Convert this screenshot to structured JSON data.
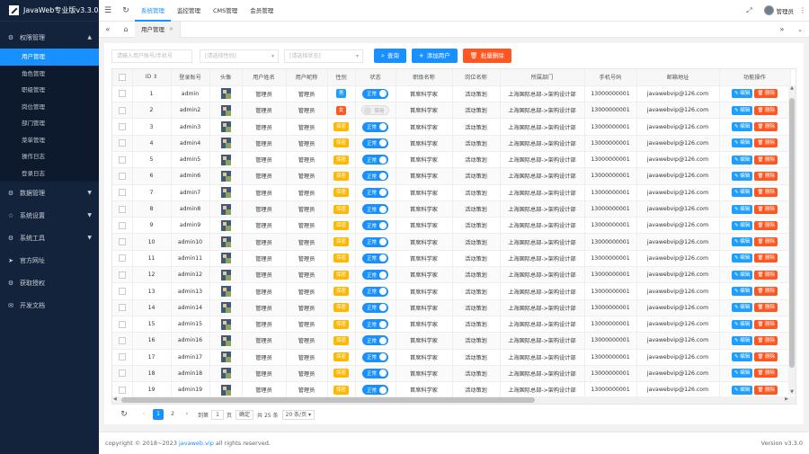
{
  "app": {
    "title": "JavaWeb专业版v3.3.0"
  },
  "sidebar": {
    "groups": [
      {
        "label": "权限管理",
        "icon": "gear-icon",
        "expanded": true,
        "items": [
          "用户管理",
          "角色管理",
          "职级管理",
          "岗位管理",
          "部门管理",
          "菜单管理",
          "操作日志",
          "登录日志"
        ],
        "active_item": "用户管理"
      },
      {
        "label": "数据管理",
        "icon": "gear-icon"
      },
      {
        "label": "系统设置",
        "icon": "star-icon"
      },
      {
        "label": "系统工具",
        "icon": "gear-icon"
      },
      {
        "label": "官方网址",
        "icon": "send-icon"
      },
      {
        "label": "获取授权",
        "icon": "gear-icon"
      },
      {
        "label": "开发文档",
        "icon": "chat-icon"
      }
    ]
  },
  "topnav": {
    "tabs": [
      "系统管理",
      "监控管理",
      "CMS管理",
      "会员管理"
    ],
    "active": "系统管理",
    "user": "管理员"
  },
  "pagetabs": {
    "current": "用户管理"
  },
  "toolbar": {
    "search_placeholder": "请输入用户账号/手机号",
    "select1_placeholder": "[请选择性别]",
    "select2_placeholder": "[请选择状态]",
    "query_label": "查询",
    "add_label": "添加用户",
    "batch_delete_label": "批量删除"
  },
  "table": {
    "headers": [
      "ID",
      "登录账号",
      "头像",
      "用户姓名",
      "用户昵称",
      "性别",
      "状态",
      "职级名称",
      "岗位名称",
      "所属部门",
      "手机号码",
      "邮箱地址",
      "功能操作"
    ],
    "status_on": "正常",
    "status_off": "禁用",
    "edit_label": "编辑",
    "delete_label": "删除",
    "rows": [
      {
        "id": "1",
        "account": "admin",
        "name": "管理员",
        "nick": "管理员",
        "gender": "男",
        "gtype": "male",
        "status": "on",
        "level": "首席科学家",
        "post": "活动策划",
        "dept": "上海国际总部->架构设计部",
        "phone": "13000000001",
        "email": "javawebvip@126.com"
      },
      {
        "id": "2",
        "account": "admin2",
        "name": "管理员",
        "nick": "管理员",
        "gender": "女",
        "gtype": "female",
        "status": "off",
        "level": "首席科学家",
        "post": "活动策划",
        "dept": "上海国际总部->架构设计部",
        "phone": "13000000001",
        "email": "javawebvip@126.com"
      },
      {
        "id": "3",
        "account": "admin3",
        "name": "管理员",
        "nick": "管理员",
        "gender": "保密",
        "gtype": "secret",
        "status": "on",
        "level": "首席科学家",
        "post": "活动策划",
        "dept": "上海国际总部->架构设计部",
        "phone": "13000000001",
        "email": "javawebvip@126.com"
      },
      {
        "id": "4",
        "account": "admin4",
        "name": "管理员",
        "nick": "管理员",
        "gender": "保密",
        "gtype": "secret",
        "status": "on",
        "level": "首席科学家",
        "post": "活动策划",
        "dept": "上海国际总部->架构设计部",
        "phone": "13000000001",
        "email": "javawebvip@126.com"
      },
      {
        "id": "5",
        "account": "admin5",
        "name": "管理员",
        "nick": "管理员",
        "gender": "保密",
        "gtype": "secret",
        "status": "on",
        "level": "首席科学家",
        "post": "活动策划",
        "dept": "上海国际总部->架构设计部",
        "phone": "13000000001",
        "email": "javawebvip@126.com"
      },
      {
        "id": "6",
        "account": "admin6",
        "name": "管理员",
        "nick": "管理员",
        "gender": "保密",
        "gtype": "secret",
        "status": "on",
        "level": "首席科学家",
        "post": "活动策划",
        "dept": "上海国际总部->架构设计部",
        "phone": "13000000001",
        "email": "javawebvip@126.com"
      },
      {
        "id": "7",
        "account": "admin7",
        "name": "管理员",
        "nick": "管理员",
        "gender": "保密",
        "gtype": "secret",
        "status": "on",
        "level": "首席科学家",
        "post": "活动策划",
        "dept": "上海国际总部->架构设计部",
        "phone": "13000000001",
        "email": "javawebvip@126.com"
      },
      {
        "id": "8",
        "account": "admin8",
        "name": "管理员",
        "nick": "管理员",
        "gender": "保密",
        "gtype": "secret",
        "status": "on",
        "level": "首席科学家",
        "post": "活动策划",
        "dept": "上海国际总部->架构设计部",
        "phone": "13000000001",
        "email": "javawebvip@126.com"
      },
      {
        "id": "9",
        "account": "admin9",
        "name": "管理员",
        "nick": "管理员",
        "gender": "保密",
        "gtype": "secret",
        "status": "on",
        "level": "首席科学家",
        "post": "活动策划",
        "dept": "上海国际总部->架构设计部",
        "phone": "13000000001",
        "email": "javawebvip@126.com"
      },
      {
        "id": "10",
        "account": "admin10",
        "name": "管理员",
        "nick": "管理员",
        "gender": "保密",
        "gtype": "secret",
        "status": "on",
        "level": "首席科学家",
        "post": "活动策划",
        "dept": "上海国际总部->架构设计部",
        "phone": "13000000001",
        "email": "javawebvip@126.com"
      },
      {
        "id": "11",
        "account": "admin11",
        "name": "管理员",
        "nick": "管理员",
        "gender": "保密",
        "gtype": "secret",
        "status": "on",
        "level": "首席科学家",
        "post": "活动策划",
        "dept": "上海国际总部->架构设计部",
        "phone": "13000000001",
        "email": "javawebvip@126.com"
      },
      {
        "id": "12",
        "account": "admin12",
        "name": "管理员",
        "nick": "管理员",
        "gender": "保密",
        "gtype": "secret",
        "status": "on",
        "level": "首席科学家",
        "post": "活动策划",
        "dept": "上海国际总部->架构设计部",
        "phone": "13000000001",
        "email": "javawebvip@126.com"
      },
      {
        "id": "13",
        "account": "admin13",
        "name": "管理员",
        "nick": "管理员",
        "gender": "保密",
        "gtype": "secret",
        "status": "on",
        "level": "首席科学家",
        "post": "活动策划",
        "dept": "上海国际总部->架构设计部",
        "phone": "13000000001",
        "email": "javawebvip@126.com"
      },
      {
        "id": "14",
        "account": "admin14",
        "name": "管理员",
        "nick": "管理员",
        "gender": "保密",
        "gtype": "secret",
        "status": "on",
        "level": "首席科学家",
        "post": "活动策划",
        "dept": "上海国际总部->架构设计部",
        "phone": "13000000001",
        "email": "javawebvip@126.com"
      },
      {
        "id": "15",
        "account": "admin15",
        "name": "管理员",
        "nick": "管理员",
        "gender": "保密",
        "gtype": "secret",
        "status": "on",
        "level": "首席科学家",
        "post": "活动策划",
        "dept": "上海国际总部->架构设计部",
        "phone": "13000000001",
        "email": "javawebvip@126.com"
      },
      {
        "id": "16",
        "account": "admin16",
        "name": "管理员",
        "nick": "管理员",
        "gender": "保密",
        "gtype": "secret",
        "status": "on",
        "level": "首席科学家",
        "post": "活动策划",
        "dept": "上海国际总部->架构设计部",
        "phone": "13000000001",
        "email": "javawebvip@126.com"
      },
      {
        "id": "17",
        "account": "admin17",
        "name": "管理员",
        "nick": "管理员",
        "gender": "保密",
        "gtype": "secret",
        "status": "on",
        "level": "首席科学家",
        "post": "活动策划",
        "dept": "上海国际总部->架构设计部",
        "phone": "13000000001",
        "email": "javawebvip@126.com"
      },
      {
        "id": "18",
        "account": "admin18",
        "name": "管理员",
        "nick": "管理员",
        "gender": "保密",
        "gtype": "secret",
        "status": "on",
        "level": "首席科学家",
        "post": "活动策划",
        "dept": "上海国际总部->架构设计部",
        "phone": "13000000001",
        "email": "javawebvip@126.com"
      },
      {
        "id": "19",
        "account": "admin19",
        "name": "管理员",
        "nick": "管理员",
        "gender": "保密",
        "gtype": "secret",
        "status": "on",
        "level": "首席科学家",
        "post": "活动策划",
        "dept": "上海国际总部->架构设计部",
        "phone": "13000000001",
        "email": "javawebvip@126.com"
      }
    ]
  },
  "pager": {
    "pages": [
      "1",
      "2"
    ],
    "current": "1",
    "goto_label": "到第",
    "goto_value": "1",
    "page_unit": "页",
    "confirm_label": "确定",
    "total_text": "共 25 条",
    "page_size": "20 条/页"
  },
  "footer": {
    "copyright_prefix": "copyright © 2018~2023",
    "link": "javaweb.vip",
    "copyright_suffix": "all rights reserved.",
    "version": "Version v3.3.0"
  }
}
